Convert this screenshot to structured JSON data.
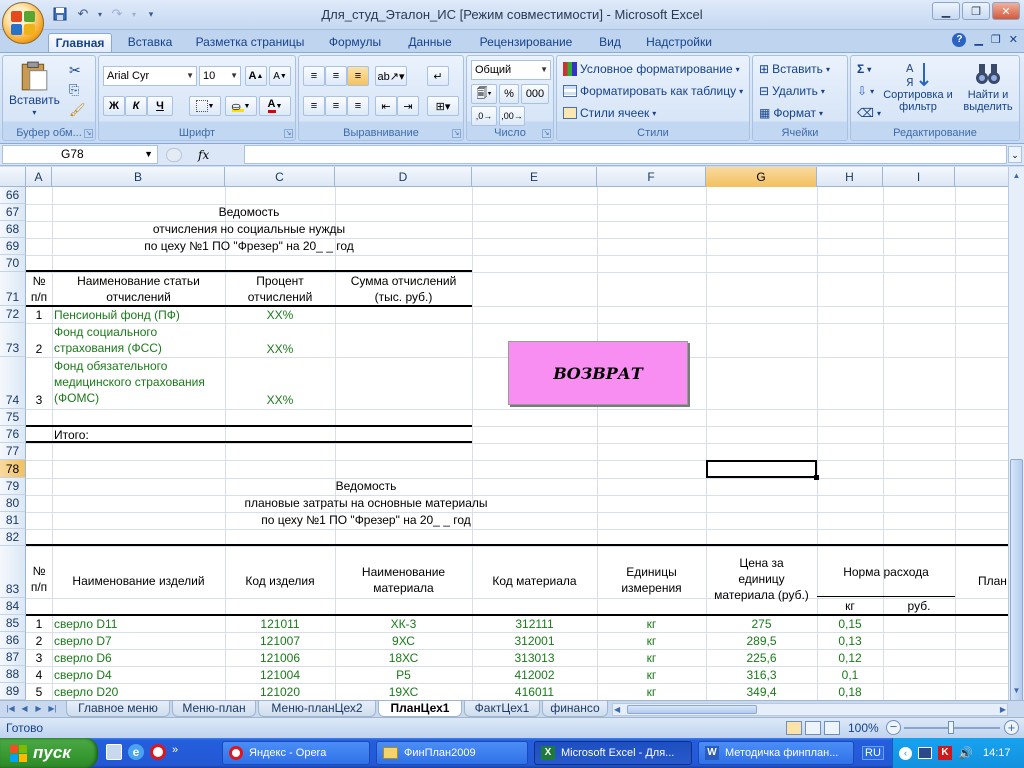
{
  "window": {
    "title": "Для_студ_Эталон_ИС  [Режим совместимости] - Microsoft Excel"
  },
  "ribbon_tabs": [
    "Главная",
    "Вставка",
    "Разметка страницы",
    "Формулы",
    "Данные",
    "Рецензирование",
    "Вид",
    "Надстройки"
  ],
  "ribbon": {
    "clipboard": {
      "paste": "Вставить",
      "label": "Буфер обм..."
    },
    "font": {
      "name": "Arial Cyr",
      "size": "10",
      "bold": "Ж",
      "italic": "К",
      "underline": "Ч",
      "label": "Шрифт"
    },
    "alignment": {
      "label": "Выравнивание"
    },
    "number": {
      "format": "Общий",
      "percent": "%",
      "thousands": "000",
      "label": "Число"
    },
    "styles": {
      "conditional": "Условное форматирование",
      "as_table": "Форматировать как таблицу",
      "cell_styles": "Стили ячеек",
      "label": "Стили"
    },
    "cells": {
      "insert": "Вставить",
      "delete": "Удалить",
      "format": "Формат",
      "label": "Ячейки"
    },
    "editing": {
      "sum": "Σ",
      "sort": "Сортировка и фильтр",
      "find": "Найти и выделить",
      "label": "Редактирование"
    }
  },
  "formula_bar": {
    "name_box": "G78",
    "fx": "fx",
    "value": ""
  },
  "columns": [
    "A",
    "B",
    "C",
    "D",
    "E",
    "F",
    "G",
    "H",
    "I"
  ],
  "selected_column": "G",
  "selected_row": "78",
  "rows": [
    "66",
    "67",
    "68",
    "69",
    "70",
    "71",
    "72",
    "73",
    "74",
    "75",
    "76",
    "77",
    "78",
    "79",
    "80",
    "81",
    "82",
    "83",
    "84",
    "85",
    "86",
    "87",
    "88",
    "89"
  ],
  "table1": {
    "title": [
      "Ведомость",
      "отчисления но социальные нужды",
      "по цеху №1 ПО \"Фрезер\" на 20_ _ год"
    ],
    "headers": {
      "num": [
        "№",
        "п/п"
      ],
      "name": [
        "Наименование статьи",
        "отчислений"
      ],
      "pct": [
        "Процент",
        "отчислений"
      ],
      "sum": [
        "Сумма отчислений",
        "(тыс. руб.)"
      ]
    },
    "rows": [
      {
        "n": "1",
        "name": [
          "Пенсионый фонд (ПФ)"
        ],
        "pct": "ХХ%"
      },
      {
        "n": "2",
        "name": [
          "Фонд социального",
          "страхования (ФСС)"
        ],
        "pct": "ХХ%"
      },
      {
        "n": "3",
        "name": [
          "Фонд обязательного",
          "медицинского страхования",
          "(ФОМС)"
        ],
        "pct": "ХХ%"
      }
    ],
    "total": "Итого:"
  },
  "button": {
    "label": "ВОЗВРАТ"
  },
  "table2": {
    "title": [
      "Ведомость",
      "плановые затраты на основные материалы",
      "по цеху №1 ПО \"Фрезер\" на 20_ _ год"
    ],
    "headers": {
      "num": [
        "№",
        "п/п"
      ],
      "product": "Наименование изделий",
      "code": "Код изделия",
      "material": [
        "Наименование",
        "материала"
      ],
      "mat_code": "Код материала",
      "unit": [
        "Единицы",
        "измерения"
      ],
      "price": [
        "Цена за",
        "единицу",
        "материала (руб.)"
      ],
      "norm": "Норма расхода",
      "kg": "кг",
      "rub": "руб.",
      "plan": "План"
    },
    "rows": [
      {
        "n": "1",
        "product": "сверло D11",
        "code": "121011",
        "material": "ХК-3",
        "mat_code": "312111",
        "unit": "кг",
        "price": "275",
        "kg": "0,15"
      },
      {
        "n": "2",
        "product": "сверло D7",
        "code": "121007",
        "material": "9ХС",
        "mat_code": "312001",
        "unit": "кг",
        "price": "289,5",
        "kg": "0,13"
      },
      {
        "n": "3",
        "product": "сверло D6",
        "code": "121006",
        "material": "18ХС",
        "mat_code": "313013",
        "unit": "кг",
        "price": "225,6",
        "kg": "0,12"
      },
      {
        "n": "4",
        "product": "сверло D4",
        "code": "121004",
        "material": "Р5",
        "mat_code": "412002",
        "unit": "кг",
        "price": "316,3",
        "kg": "0,1"
      },
      {
        "n": "5",
        "product": "сверло D20",
        "code": "121020",
        "material": "19ХС",
        "mat_code": "416011",
        "unit": "кг",
        "price": "349,4",
        "kg": "0,18"
      }
    ]
  },
  "sheet_tabs": [
    "Главное меню",
    "Меню-план",
    "Меню-планЦех2",
    "ПланЦех1",
    "ФактЦех1",
    "финансо"
  ],
  "active_sheet": "ПланЦех1",
  "status": {
    "ready": "Готово",
    "zoom": "100%"
  },
  "taskbar": {
    "start": "пуск",
    "items": [
      "Яндекс - Opera",
      "ФинПлан2009",
      "Microsoft Excel - Для...",
      "Методичка финплан..."
    ],
    "active": "Microsoft Excel - Для...",
    "lang": "RU",
    "clock": "14:17"
  }
}
